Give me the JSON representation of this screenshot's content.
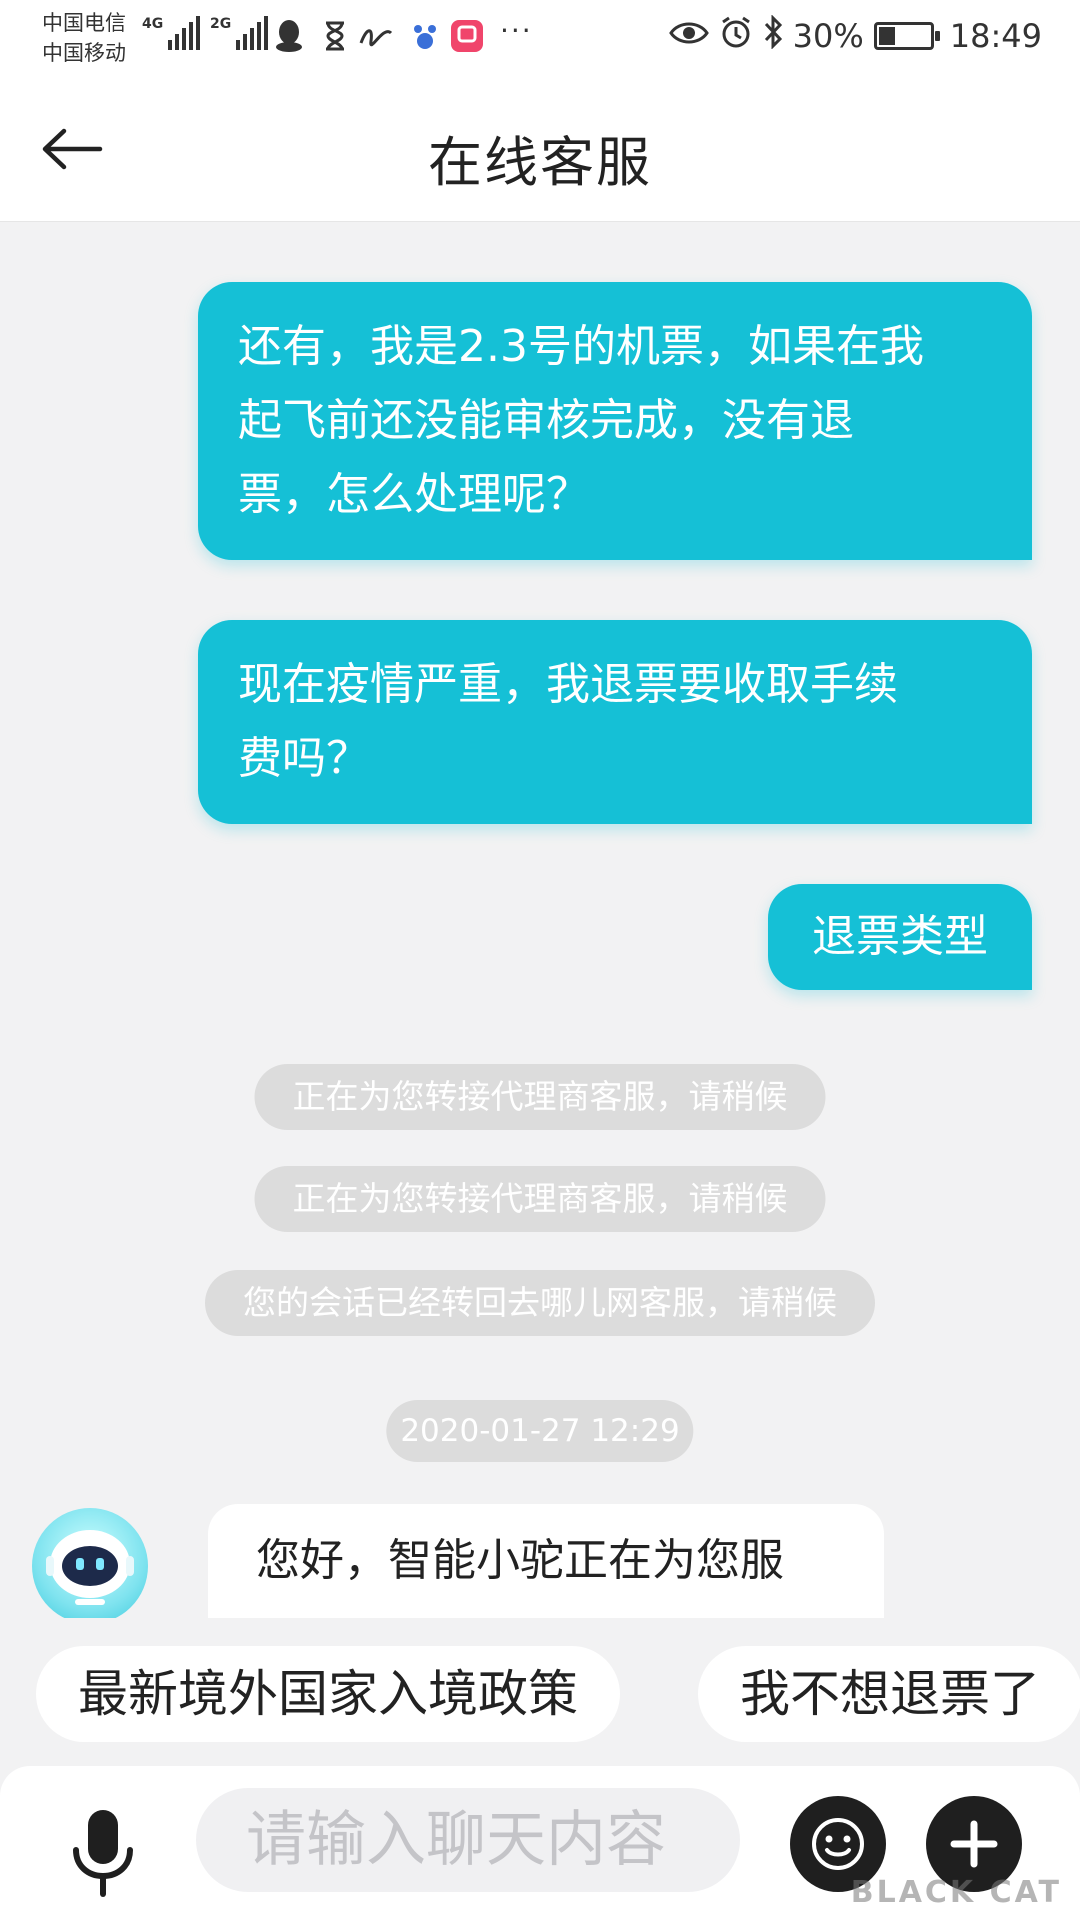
{
  "status_bar": {
    "carrier_1": "中国电信",
    "carrier_2": "中国移动",
    "net_1": "4G",
    "net_2": "2G",
    "battery_percent_text": "30%",
    "battery_level": 0.3,
    "time": "18:49",
    "overflow": "···"
  },
  "header": {
    "title": "在线客服"
  },
  "messages": [
    {
      "from": "user",
      "text_lines": [
        "还有，我是2.3号的机票，如果在我",
        "起飞前还没能审核完成，没有退",
        "票，怎么处理呢？"
      ]
    },
    {
      "from": "user",
      "text_lines": [
        "现在疫情严重，我退票要收取手续",
        "费吗？"
      ]
    },
    {
      "from": "user",
      "text_lines": [
        "退票类型"
      ]
    }
  ],
  "system_notices": [
    "正在为您转接代理商客服，请稍候",
    "正在为您转接代理商客服，请稍候",
    "您的会话已经转回去哪儿网客服，请稍候"
  ],
  "timestamp": "2020-01-27 12:29",
  "bot_message": "您好，智能小驼正在为您服",
  "quick_replies": [
    "最新境外国家入境政策",
    "我不想退票了"
  ],
  "input": {
    "placeholder": "请输入聊天内容"
  },
  "watermark": "BLACK CAT",
  "colors": {
    "accent": "#15c0d6",
    "background": "#f2f2f3",
    "pill": "#dcdcdc"
  },
  "icons": [
    "back-arrow-icon",
    "microphone-icon",
    "emoji-icon",
    "plus-icon",
    "robot-avatar-icon"
  ]
}
